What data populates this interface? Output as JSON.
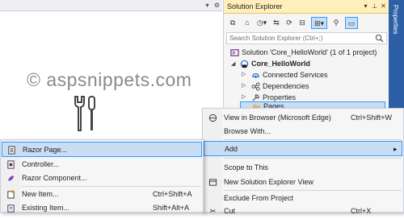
{
  "editor": {
    "watermark": "© aspsnippets.com",
    "dropdown_glyph": "▾",
    "gear_glyph": "⚙"
  },
  "solution_explorer": {
    "title": "Solution Explorer",
    "search_placeholder": "Search Solution Explorer (Ctrl+;)",
    "tree": {
      "solution": "Solution 'Core_HelloWorld' (1 of 1 project)",
      "project": "Core_HelloWorld",
      "items": [
        {
          "label": "Connected Services"
        },
        {
          "label": "Dependencies"
        },
        {
          "label": "Properties"
        },
        {
          "label": "Pages"
        }
      ]
    }
  },
  "properties_tab": {
    "label": "Properties"
  },
  "context_menu": {
    "items": [
      {
        "label": "View in Browser (Microsoft Edge)",
        "shortcut": "Ctrl+Shift+W"
      },
      {
        "label": "Browse With...",
        "shortcut": ""
      },
      {
        "label": "Add",
        "shortcut": "",
        "submenu_arrow": "▸"
      },
      {
        "label": "Scope to This",
        "shortcut": ""
      },
      {
        "label": "New Solution Explorer View",
        "shortcut": ""
      },
      {
        "label": "Exclude From Project",
        "shortcut": ""
      },
      {
        "label": "Cut",
        "shortcut": "Ctrl+X"
      }
    ]
  },
  "add_submenu": {
    "items": [
      {
        "label": "Razor Page...",
        "shortcut": ""
      },
      {
        "label": "Controller...",
        "shortcut": ""
      },
      {
        "label": "Razor Component...",
        "shortcut": ""
      },
      {
        "label": "New Item...",
        "shortcut": "Ctrl+Shift+A"
      },
      {
        "label": "Existing Item...",
        "shortcut": "Shift+Alt+A"
      }
    ]
  },
  "colors": {
    "accent": "#3399ff",
    "highlight": "#c9def5",
    "title_active": "#ffefbb",
    "properties_tab": "#2d5fa6"
  }
}
